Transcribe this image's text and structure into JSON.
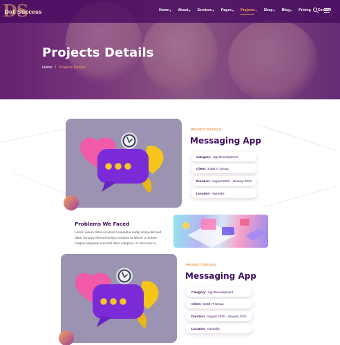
{
  "brand": {
    "monogram": "DS",
    "name": "Dot Success"
  },
  "nav": {
    "items": [
      {
        "label": "Home",
        "caret": true
      },
      {
        "label": "About",
        "caret": true
      },
      {
        "label": "Services",
        "caret": true
      },
      {
        "label": "Pages",
        "caret": true
      },
      {
        "label": "Projects",
        "caret": true,
        "active": true
      },
      {
        "label": "Shop",
        "caret": true
      },
      {
        "label": "Blog",
        "caret": true
      },
      {
        "label": "Pricing",
        "caret": false
      },
      {
        "label": "Contact",
        "caret": false
      }
    ],
    "caret_glyph": "▾",
    "icons": [
      "search-icon",
      "menu-icon"
    ]
  },
  "hero": {
    "title": "Projects Details",
    "breadcrumb": {
      "home": "Home",
      "sep": "/",
      "current": "Projects Details"
    }
  },
  "project1": {
    "label": "PROJECT DETAILS",
    "title": "Messaging App",
    "details": [
      {
        "key": "Category:",
        "value": "App Development"
      },
      {
        "key": "Client:",
        "value": "SoBit IT Group"
      },
      {
        "key": "Duration:",
        "value": "August 2020 - January 2021"
      },
      {
        "key": "Location:",
        "value": "Australia"
      }
    ]
  },
  "problems": {
    "title": "Problems We Faced",
    "lines": [
      "Lorem ipsum dolor sit amet consetetur sadip scing elitr sed",
      "diam nonumy eirmod tempor invidunt ut labore et dolore",
      "magna aliquyam erat sed diam voluptua. At vero eos et"
    ]
  },
  "project2": {
    "label": "PROJECT DETAILS",
    "title": "Messaging App",
    "details": [
      {
        "key": "Category:",
        "value": "App Development"
      },
      {
        "key": "Client:",
        "value": "SoBit IT Group"
      },
      {
        "key": "Duration:",
        "value": "August 2020 - January 2021"
      },
      {
        "key": "Location:",
        "value": "Australia"
      }
    ]
  },
  "colors": {
    "accent": "#f5a45a",
    "primary": "#3d0e5e",
    "hero": "#6a2a73",
    "card": "#9b93b1"
  }
}
